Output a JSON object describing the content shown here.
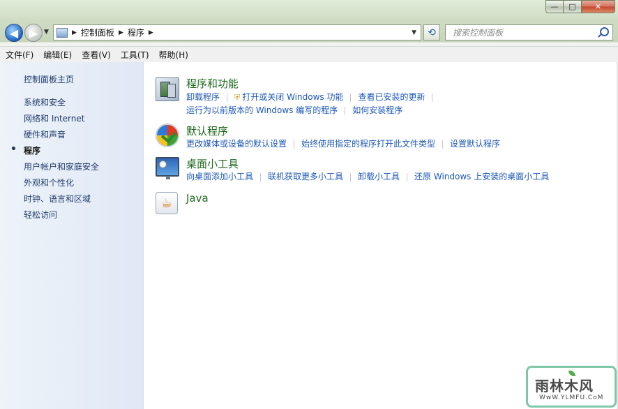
{
  "window": {
    "caption_buttons": {
      "minimize": "—",
      "maximize": "□",
      "close": "✕"
    }
  },
  "nav": {
    "back_icon": "back-arrow-icon",
    "forward_icon": "forward-arrow-icon",
    "breadcrumb": [
      "控制面板",
      "程序"
    ],
    "search_placeholder": "搜索控制面板"
  },
  "menubar": {
    "items": [
      "文件(F)",
      "编辑(E)",
      "查看(V)",
      "工具(T)",
      "帮助(H)"
    ]
  },
  "sidebar": {
    "home": "控制面板主页",
    "items": [
      "系统和安全",
      "网络和 Internet",
      "硬件和声音",
      "程序",
      "用户帐户和家庭安全",
      "外观和个性化",
      "时钟、语言和区域",
      "轻松访问"
    ],
    "current": "程序"
  },
  "categories": [
    {
      "title": "程序和功能",
      "icon": "programs-features-icon",
      "link_rows": [
        [
          "卸载程序",
          "打开或关闭 Windows 功能",
          "查看已安装的更新"
        ],
        [
          "运行为以前版本的 Windows 编写的程序",
          "如何安装程序"
        ]
      ]
    },
    {
      "title": "默认程序",
      "icon": "default-programs-icon",
      "link_rows": [
        [
          "更改媒体或设备的默认设置",
          "始终使用指定的程序打开此文件类型",
          "设置默认程序"
        ]
      ]
    },
    {
      "title": "桌面小工具",
      "icon": "desktop-gadgets-icon",
      "link_rows": [
        [
          "向桌面添加小工具",
          "联机获取更多小工具",
          "卸载小工具",
          "还原 Windows 上安装的桌面小工具"
        ]
      ]
    },
    {
      "title": "Java",
      "icon": "java-icon",
      "link_rows": []
    }
  ],
  "watermark": {
    "main": "雨林木风",
    "sub": "WwW.YLMFU.CoM"
  }
}
